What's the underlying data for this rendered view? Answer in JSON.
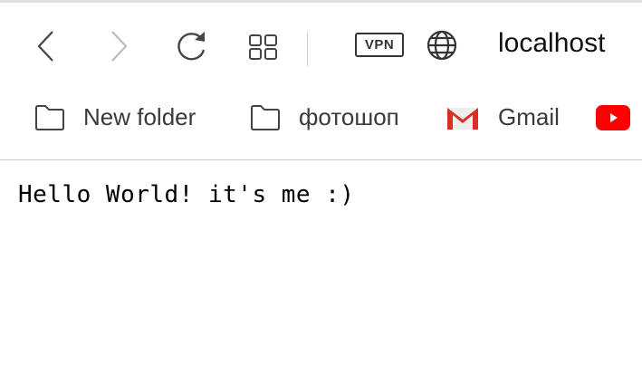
{
  "toolbar": {
    "vpn_label": "VPN",
    "address": "localhost"
  },
  "bookmarks": [
    {
      "label": "New folder",
      "icon": "folder-icon"
    },
    {
      "label": "фотошоп",
      "icon": "folder-icon"
    },
    {
      "label": "Gmail",
      "icon": "gmail-icon"
    },
    {
      "label": "",
      "icon": "youtube-icon"
    }
  ],
  "page": {
    "text": "Hello World! it's me :)"
  }
}
